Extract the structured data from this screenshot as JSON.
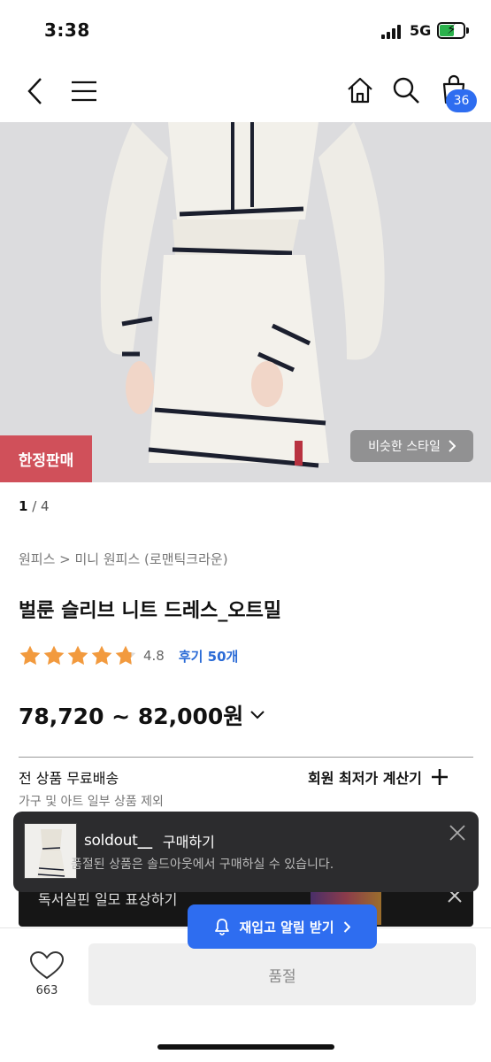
{
  "status_bar": {
    "time": "3:38",
    "network": "5G"
  },
  "nav": {
    "cart_count": "36"
  },
  "hero": {
    "badge": "한정판매",
    "similar_style": "비슷한 스타일",
    "pager_current": "1",
    "pager_total": "/ 4"
  },
  "product": {
    "breadcrumb": "원피스 > 미니 원피스 (로맨틱크라운)",
    "title": "벌룬 슬리브 니트 드레스_오트밀",
    "rating": "4.8",
    "rating_stars": 4.8,
    "reviews": "후기 50개",
    "price": "78,720 ~ 82,000원"
  },
  "shipping": {
    "title": "전 상품 무료배송",
    "note": "가구 및 아트 일부 상품 제외",
    "calc_label": "회원 최저가 계산기"
  },
  "banner": {
    "text": "독서실핀 일모 표상하기"
  },
  "toast": {
    "brand": "soldout",
    "action": "구매하기",
    "message": "품절된 상품은 솔드아웃에서 구매하실 수 있습니다."
  },
  "restock": {
    "label": "재입고 알림 받기"
  },
  "bottom": {
    "likes": "663",
    "soldout_label": "품절"
  },
  "colors": {
    "accent_blue": "#2e6df0",
    "badge_red": "#d0505a",
    "star_orange": "#f29a3e"
  }
}
